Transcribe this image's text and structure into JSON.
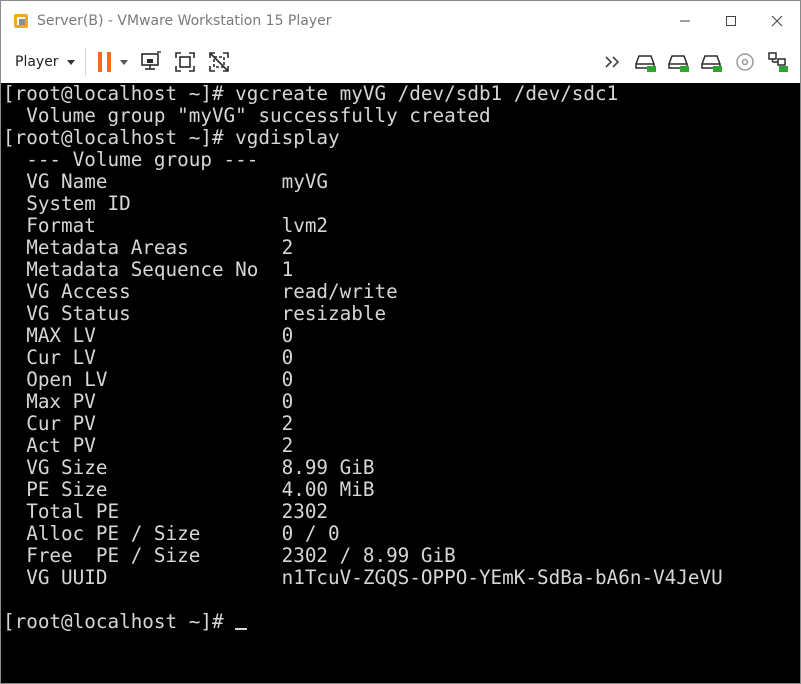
{
  "window": {
    "title": "Server(B) - VMware Workstation 15 Player",
    "controls": [
      "minimize",
      "maximize",
      "close"
    ]
  },
  "toolbar": {
    "player_label": "Player",
    "left_icons": [
      "pause-icon",
      "send-ctrl-alt-del-icon",
      "fullscreen-icon",
      "unity-icon"
    ],
    "right_icons": [
      "more-devices-icon",
      "hard-disk-icon",
      "hard-disk-icon",
      "hard-disk-icon",
      "cd-dvd-icon",
      "network-adapter-icon"
    ],
    "colors": {
      "pause": "#f06d22",
      "device_active": "#2ea52e"
    }
  },
  "terminal": {
    "lines": [
      "[root@localhost ~]# vgcreate myVG /dev/sdb1 /dev/sdc1",
      "  Volume group \"myVG\" successfully created",
      "[root@localhost ~]# vgdisplay",
      "  --- Volume group ---",
      "  VG Name               myVG",
      "  System ID",
      "  Format                lvm2",
      "  Metadata Areas        2",
      "  Metadata Sequence No  1",
      "  VG Access             read/write",
      "  VG Status             resizable",
      "  MAX LV                0",
      "  Cur LV                0",
      "  Open LV               0",
      "  Max PV                0",
      "  Cur PV                2",
      "  Act PV                2",
      "  VG Size               8.99 GiB",
      "  PE Size               4.00 MiB",
      "  Total PE              2302",
      "  Alloc PE / Size       0 / 0",
      "  Free  PE / Size       2302 / 8.99 GiB",
      "  VG UUID               n1TcuV-ZGQS-OPPO-YEmK-SdBa-bA6n-V4JeVU",
      "",
      "[root@localhost ~]# "
    ]
  }
}
